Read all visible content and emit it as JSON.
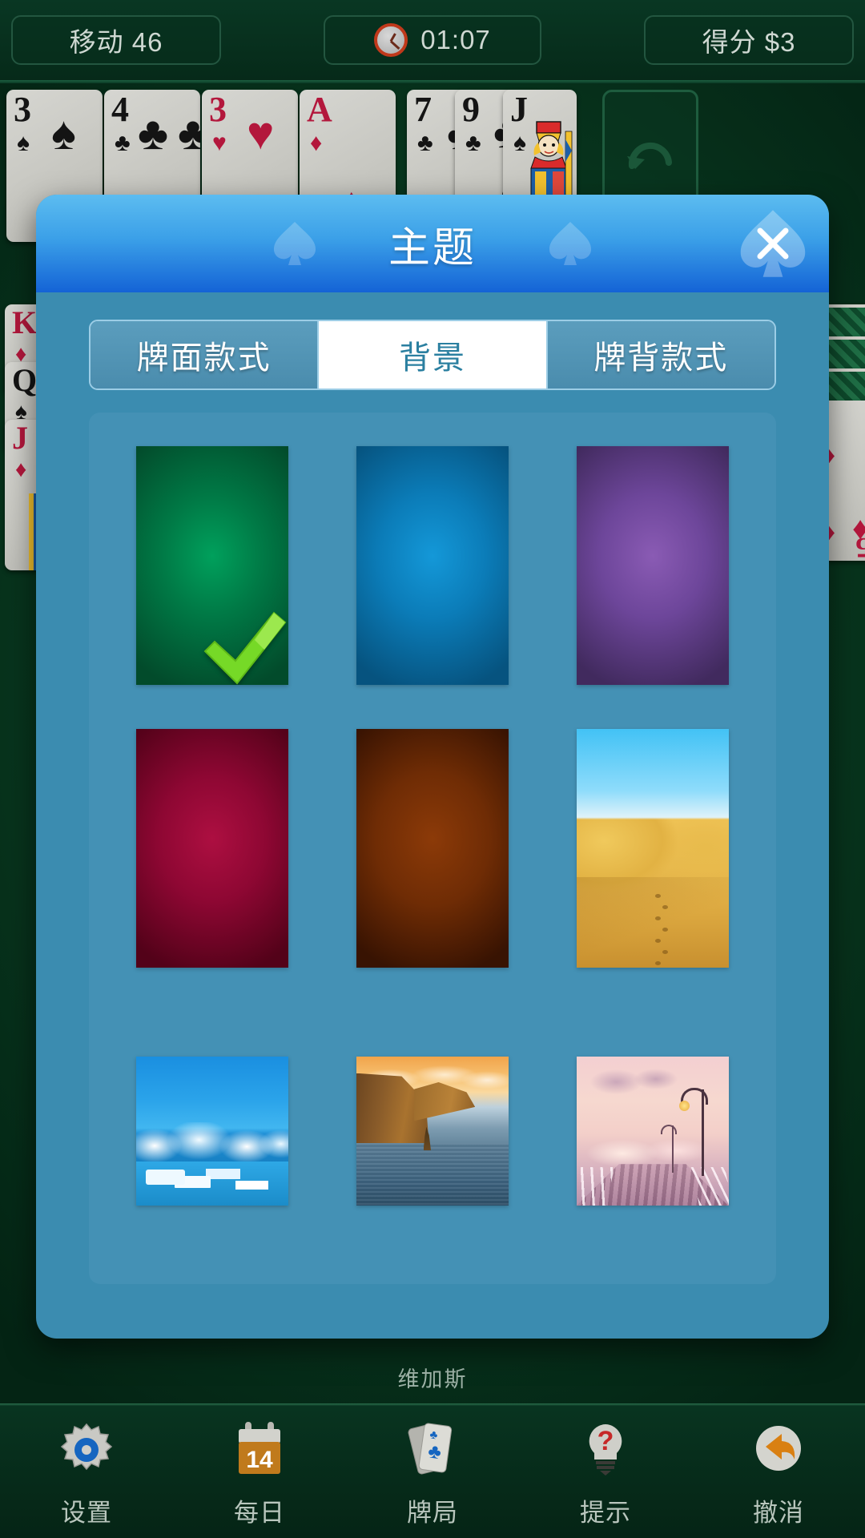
{
  "status_bar": {
    "moves_label": "移动 46",
    "timer_value": "01:07",
    "score_label": "得分 $3",
    "clock_icon": "clock-icon"
  },
  "table": {
    "mode_label": "维加斯",
    "foundation_cards": [
      {
        "rank": "3",
        "suit": "♠",
        "color": "black"
      },
      {
        "rank": "4",
        "suit": "♣",
        "color": "black"
      },
      {
        "rank": "3",
        "suit": "♥",
        "color": "red"
      },
      {
        "rank": "A",
        "suit": "♦",
        "color": "red"
      },
      {
        "rank": "7",
        "suit": "♣",
        "color": "black"
      },
      {
        "rank": "9",
        "suit": "♣",
        "color": "black"
      },
      {
        "rank": "J",
        "suit": "♠",
        "color": "black"
      }
    ],
    "left_column_cards": [
      {
        "rank": "K",
        "suit": "♦",
        "color": "red"
      },
      {
        "rank": "Q",
        "suit": "♠",
        "color": "black"
      },
      {
        "rank": "J",
        "suit": "♦",
        "color": "red"
      }
    ],
    "right_column_cards": [
      {
        "rank": "5",
        "suit": "♦",
        "color": "red"
      }
    ],
    "stock_icon": "recycle-arrow-icon"
  },
  "dialog": {
    "title": "主题",
    "close_icon": "close-icon",
    "spade_decoration_icon": "spade-icon",
    "tabs": [
      {
        "label": "牌面款式",
        "name": "tab-card-face",
        "active": false
      },
      {
        "label": "背景",
        "name": "tab-background",
        "active": true
      },
      {
        "label": "牌背款式",
        "name": "tab-card-back",
        "active": false
      }
    ],
    "selected_index": 0,
    "selected_check_icon": "check-icon",
    "themes": [
      {
        "name": "green",
        "kind": "gradient",
        "color": "#007a46",
        "edge": "#024b2b",
        "selected": true
      },
      {
        "name": "blue",
        "kind": "gradient",
        "color": "#0b84c4",
        "edge": "#05527f",
        "selected": false
      },
      {
        "name": "purple",
        "kind": "gradient",
        "color": "#7a4fa0",
        "edge": "#432a60",
        "selected": false
      },
      {
        "name": "crimson",
        "kind": "gradient",
        "color": "#9e0b38",
        "edge": "#5c0320",
        "selected": false
      },
      {
        "name": "brown",
        "kind": "gradient",
        "color": "#7a3208",
        "edge": "#3d1603",
        "selected": false
      },
      {
        "name": "desert",
        "kind": "photo",
        "photo": "ph-desert",
        "selected": false
      },
      {
        "name": "ocean-clouds",
        "kind": "photo",
        "photo": "ph-ocean",
        "selected": false
      },
      {
        "name": "cliffs-sunset",
        "kind": "photo",
        "photo": "ph-cliffs",
        "selected": false
      },
      {
        "name": "pink-pier",
        "kind": "photo",
        "photo": "ph-pier",
        "selected": false
      }
    ]
  },
  "bottom_nav": [
    {
      "label": "设置",
      "icon": "gear-icon"
    },
    {
      "label": "每日",
      "icon": "calendar-icon",
      "badge": "14"
    },
    {
      "label": "牌局",
      "icon": "cards-icon"
    },
    {
      "label": "提示",
      "icon": "lightbulb-hint-icon"
    },
    {
      "label": "撤消",
      "icon": "undo-icon"
    }
  ],
  "colors": {
    "table_green": "#08381f",
    "dialog_body": "#3b8cb0",
    "dialog_panel": "#4491b5",
    "header_blue": "#1463d6",
    "tab_active_text": "#2a7fa0",
    "check_green": "#6ed321"
  }
}
